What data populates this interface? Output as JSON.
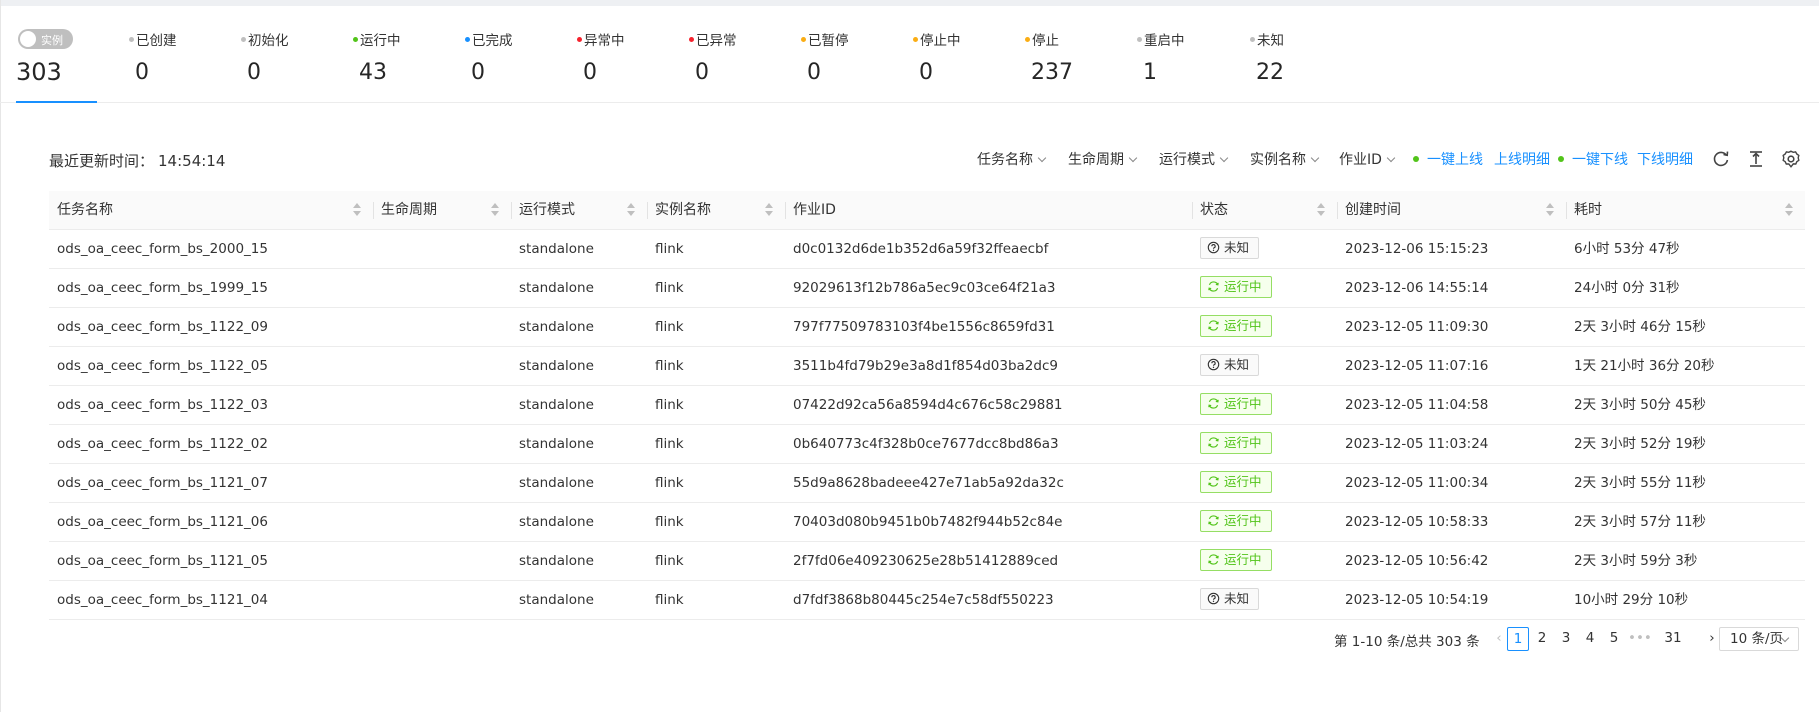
{
  "summary": {
    "toggle_label": "实例",
    "total": "303",
    "accent": "#1890ff",
    "statuses": [
      {
        "label": "已创建",
        "value": "0",
        "color": "#bfbfbf"
      },
      {
        "label": "初始化",
        "value": "0",
        "color": "#bfbfbf"
      },
      {
        "label": "运行中",
        "value": "43",
        "color": "#52c41a"
      },
      {
        "label": "已完成",
        "value": "0",
        "color": "#1890ff"
      },
      {
        "label": "异常中",
        "value": "0",
        "color": "#f5222d"
      },
      {
        "label": "已异常",
        "value": "0",
        "color": "#f5222d"
      },
      {
        "label": "已暂停",
        "value": "0",
        "color": "#faad14"
      },
      {
        "label": "停止中",
        "value": "0",
        "color": "#faad14"
      },
      {
        "label": "停止",
        "value": "237",
        "color": "#faad14"
      },
      {
        "label": "重启中",
        "value": "1",
        "color": "#bfbfbf"
      },
      {
        "label": "未知",
        "value": "22",
        "color": "#bfbfbf"
      }
    ]
  },
  "toolbar": {
    "update_label": "最近更新时间：",
    "update_time": "14:54:14",
    "filters": [
      "任务名称",
      "生命周期",
      "运行模式",
      "实例名称",
      "作业ID"
    ],
    "online_all": "一键上线",
    "online_detail": "上线明细",
    "offline_all": "一键下线",
    "offline_detail": "下线明细",
    "icons": [
      "refresh-icon",
      "column-height-icon",
      "settings-icon"
    ]
  },
  "table": {
    "columns": [
      "任务名称",
      "生命周期",
      "运行模式",
      "实例名称",
      "作业ID",
      "状态",
      "创建时间",
      "耗时"
    ],
    "rows": [
      [
        "ods_oa_ceec_form_bs_2000_15",
        "",
        "standalone",
        "flink",
        "d0c0132d6de1b352d6a59f32ffeaecbf",
        "未知",
        "2023-12-06 15:15:23",
        "6小时 53分 47秒"
      ],
      [
        "ods_oa_ceec_form_bs_1999_15",
        "",
        "standalone",
        "flink",
        "92029613f12b786a5ec9c03ce64f21a3",
        "运行中",
        "2023-12-06 14:55:14",
        "24小时 0分 31秒"
      ],
      [
        "ods_oa_ceec_form_bs_1122_09",
        "",
        "standalone",
        "flink",
        "797f77509783103f4be1556c8659fd31",
        "运行中",
        "2023-12-05 11:09:30",
        "2天 3小时 46分 15秒"
      ],
      [
        "ods_oa_ceec_form_bs_1122_05",
        "",
        "standalone",
        "flink",
        "3511b4fd79b29e3a8d1f854d03ba2dc9",
        "未知",
        "2023-12-05 11:07:16",
        "1天 21小时 36分 20秒"
      ],
      [
        "ods_oa_ceec_form_bs_1122_03",
        "",
        "standalone",
        "flink",
        "07422d92ca56a8594d4c676c58c29881",
        "运行中",
        "2023-12-05 11:04:58",
        "2天 3小时 50分 45秒"
      ],
      [
        "ods_oa_ceec_form_bs_1122_02",
        "",
        "standalone",
        "flink",
        "0b640773c4f328b0ce7677dcc8bd86a3",
        "运行中",
        "2023-12-05 11:03:24",
        "2天 3小时 52分 19秒"
      ],
      [
        "ods_oa_ceec_form_bs_1121_07",
        "",
        "standalone",
        "flink",
        "55d9a8628badeee427e71ab5a92da32c",
        "运行中",
        "2023-12-05 11:00:34",
        "2天 3小时 55分 11秒"
      ],
      [
        "ods_oa_ceec_form_bs_1121_06",
        "",
        "standalone",
        "flink",
        "70403d080b9451b0b7482f944b52c84e",
        "运行中",
        "2023-12-05 10:58:33",
        "2天 3小时 57分 11秒"
      ],
      [
        "ods_oa_ceec_form_bs_1121_05",
        "",
        "standalone",
        "flink",
        "2f7fd06e409230625e28b51412889ced",
        "运行中",
        "2023-12-05 10:56:42",
        "2天 3小时 59分 3秒"
      ],
      [
        "ods_oa_ceec_form_bs_1121_04",
        "",
        "standalone",
        "flink",
        "d7fdf3868b80445c254e7c58df550223",
        "未知",
        "2023-12-05 10:54:19",
        "10小时 29分 10秒"
      ]
    ]
  },
  "pagination": {
    "total_text": "第 1-10 条/总共 303 条",
    "pages": [
      "1",
      "2",
      "3",
      "4",
      "5",
      "•••",
      "31"
    ],
    "current": "1",
    "page_size": "10 条/页"
  }
}
